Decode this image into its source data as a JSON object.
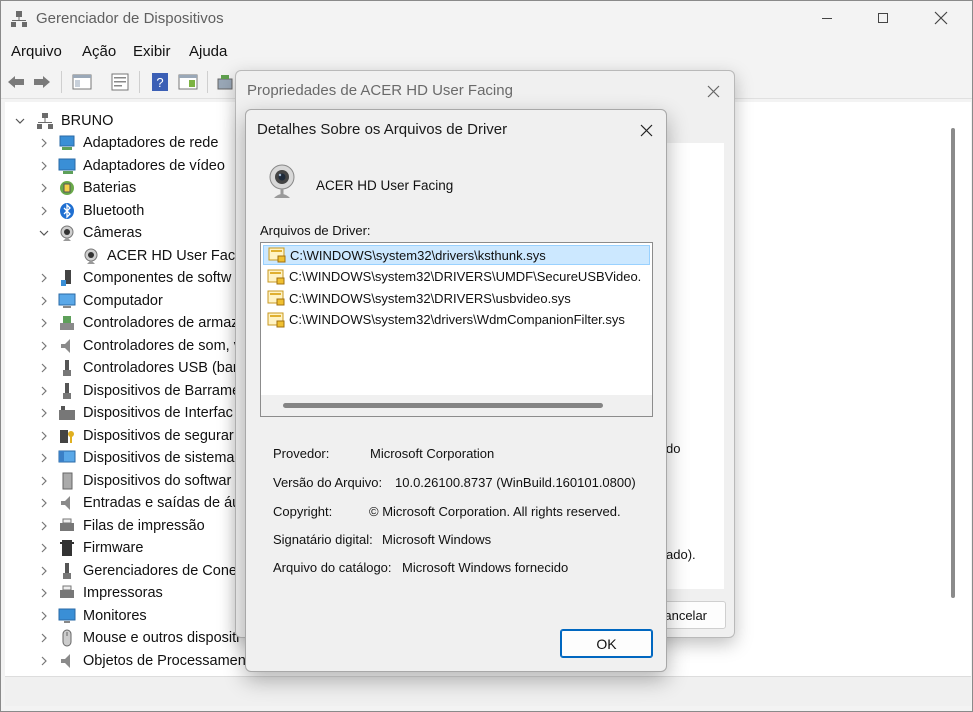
{
  "window": {
    "title": "Gerenciador de Dispositivos"
  },
  "menu": [
    "Arquivo",
    "Ação",
    "Exibir",
    "Ajuda"
  ],
  "tree": {
    "root": "BRUNO",
    "items": [
      {
        "label": "Adaptadores de rede",
        "icon": "network-adapter-icon"
      },
      {
        "label": "Adaptadores de vídeo",
        "icon": "display-adapter-icon"
      },
      {
        "label": "Baterias",
        "icon": "battery-icon"
      },
      {
        "label": "Bluetooth",
        "icon": "bluetooth-icon"
      },
      {
        "label": "Câmeras",
        "icon": "camera-icon"
      },
      {
        "label": "ACER HD User Facin",
        "icon": "webcam-icon"
      },
      {
        "label": "Componentes de softw",
        "icon": "software-component-icon"
      },
      {
        "label": "Computador",
        "icon": "computer-icon"
      },
      {
        "label": "Controladores de armaz",
        "icon": "storage-controller-icon"
      },
      {
        "label": "Controladores de som, v",
        "icon": "sound-controller-icon"
      },
      {
        "label": "Controladores USB (bar",
        "icon": "usb-controller-icon"
      },
      {
        "label": "Dispositivos de Barrame",
        "icon": "bus-device-icon"
      },
      {
        "label": "Dispositivos de Interfac",
        "icon": "hid-device-icon"
      },
      {
        "label": "Dispositivos de segurar",
        "icon": "security-device-icon"
      },
      {
        "label": "Dispositivos de sistema",
        "icon": "system-device-icon"
      },
      {
        "label": "Dispositivos do softwar",
        "icon": "software-device-icon"
      },
      {
        "label": "Entradas e saídas de áu",
        "icon": "audio-io-icon"
      },
      {
        "label": "Filas de impressão",
        "icon": "print-queue-icon"
      },
      {
        "label": "Firmware",
        "icon": "firmware-icon"
      },
      {
        "label": "Gerenciadores de Conec",
        "icon": "connector-manager-icon"
      },
      {
        "label": "Impressoras",
        "icon": "printer-icon"
      },
      {
        "label": "Monitores",
        "icon": "monitor-icon"
      },
      {
        "label": "Mouse e outros dispositi",
        "icon": "mouse-icon"
      },
      {
        "label": "Objetos de Processament",
        "icon": "processing-object-icon"
      }
    ]
  },
  "properties_dialog": {
    "title": "Propriedades de ACER HD User Facing",
    "fragment1": "do",
    "fragment2": "ado).",
    "cancel_label": "ancelar"
  },
  "driver_dialog": {
    "title": "Detalhes Sobre os Arquivos de Driver",
    "device_name": "ACER HD User Facing",
    "files_label": "Arquivos de Driver:",
    "files": [
      "C:\\WINDOWS\\system32\\drivers\\ksthunk.sys",
      "C:\\WINDOWS\\system32\\DRIVERS\\UMDF\\SecureUSBVideo.",
      "C:\\WINDOWS\\system32\\DRIVERS\\usbvideo.sys",
      "C:\\WINDOWS\\system32\\drivers\\WdmCompanionFilter.sys"
    ],
    "selected_file_index": 0,
    "provider_label": "Provedor:",
    "provider_value": "Microsoft Corporation",
    "version_label": "Versão do Arquivo:",
    "version_value": "10.0.26100.8737 (WinBuild.160101.0800)",
    "copyright_label": "Copyright:",
    "copyright_value": "© Microsoft Corporation. All rights reserved.",
    "signer_label": "Signatário digital:",
    "signer_value": "Microsoft Windows",
    "catalog_label": "Arquivo do catálogo:",
    "catalog_value": "Microsoft Windows fornecido",
    "ok_label": "OK"
  }
}
